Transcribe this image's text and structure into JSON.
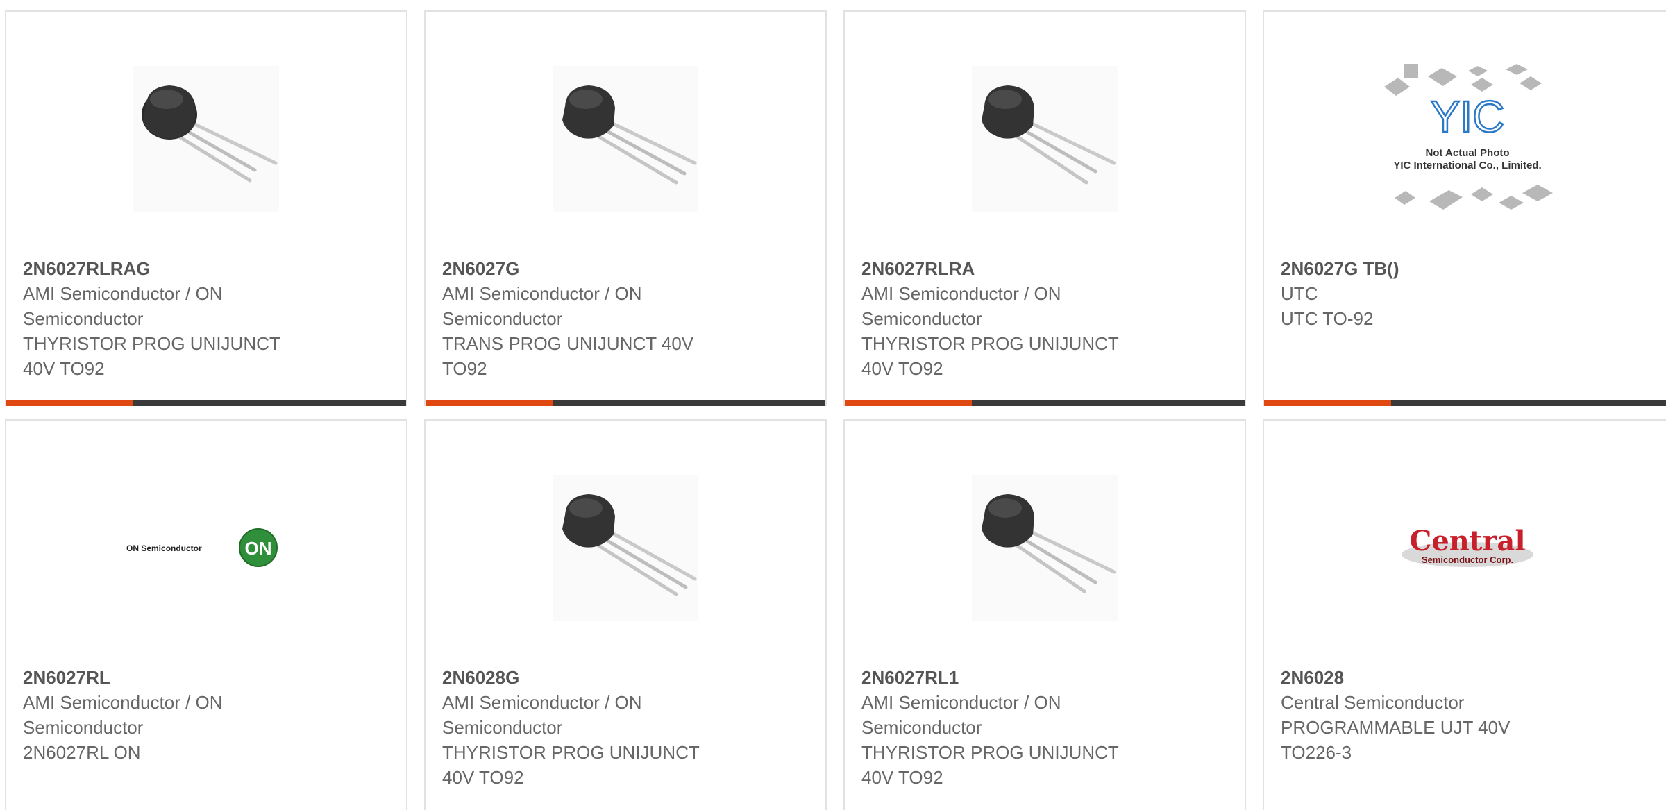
{
  "colors": {
    "accent": "#e04812",
    "bar": "#3a3a3a",
    "border": "#e2e2e2",
    "text": "#666666"
  },
  "cards": [
    {
      "part_number": "2N6027RLRAG",
      "manufacturer_line1": "AMI Semiconductor / ON",
      "manufacturer_line2": "Semiconductor",
      "desc_line1": "THYRISTOR PROG UNIJUNCT",
      "desc_line2": "40V TO92",
      "image": "to92-transistor-photo"
    },
    {
      "part_number": "2N6027G",
      "manufacturer_line1": "AMI Semiconductor / ON",
      "manufacturer_line2": "Semiconductor",
      "desc_line1": "TRANS PROG UNIJUNCT 40V",
      "desc_line2": "TO92",
      "image": "to92-transistor-photo"
    },
    {
      "part_number": "2N6027RLRA",
      "manufacturer_line1": "AMI Semiconductor / ON",
      "manufacturer_line2": "Semiconductor",
      "desc_line1": "THYRISTOR PROG UNIJUNCT",
      "desc_line2": "40V TO92",
      "image": "to92-transistor-photo"
    },
    {
      "part_number": "2N6027G TB()",
      "manufacturer_line1": "UTC",
      "manufacturer_line2": "UTC TO-92",
      "desc_line1": "",
      "desc_line2": "",
      "image": "yic-placeholder",
      "placeholder_text1": "Not Actual Photo",
      "placeholder_text2": "YIC International Co., Limited."
    },
    {
      "part_number": "2N6027RL",
      "manufacturer_line1": "AMI Semiconductor / ON",
      "manufacturer_line2": "Semiconductor",
      "desc_line1": "2N6027RL ON",
      "desc_line2": "",
      "image": "on-semiconductor-logo",
      "logo_text": "ON Semiconductor",
      "logo_badge": "ON"
    },
    {
      "part_number": "2N6028G",
      "manufacturer_line1": "AMI Semiconductor / ON",
      "manufacturer_line2": "Semiconductor",
      "desc_line1": "THYRISTOR PROG UNIJUNCT",
      "desc_line2": "40V TO92",
      "image": "to92-transistor-photo"
    },
    {
      "part_number": "2N6027RL1",
      "manufacturer_line1": "AMI Semiconductor / ON",
      "manufacturer_line2": "Semiconductor",
      "desc_line1": "THYRISTOR PROG UNIJUNCT",
      "desc_line2": "40V TO92",
      "image": "to92-transistor-photo"
    },
    {
      "part_number": "2N6028",
      "manufacturer_line1": "Central Semiconductor",
      "manufacturer_line2": "PROGRAMMABLE UJT 40V",
      "desc_line1": "TO226-3",
      "desc_line2": "",
      "image": "central-semiconductor-logo",
      "logo_text": "Central",
      "logo_subtext": "Semiconductor Corp."
    }
  ]
}
